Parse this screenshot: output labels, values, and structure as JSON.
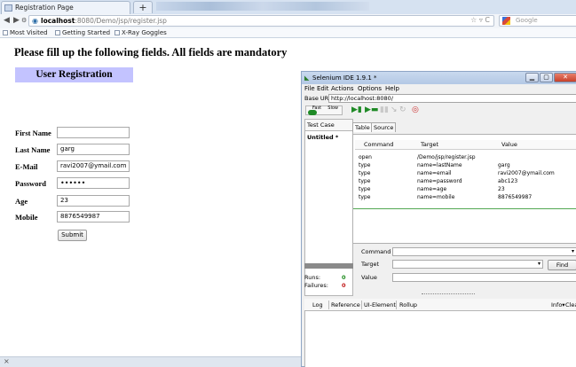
{
  "browser": {
    "tab_title": "Registration Page",
    "new_tab": "+",
    "url_host": "localhost",
    "url_path": ":8080/Demo/jsp/register.jsp",
    "search_placeholder": "Google",
    "bookmarks": [
      "Most Visited",
      "Getting Started",
      "X-Ray Goggles"
    ],
    "status_icon": "×"
  },
  "page": {
    "heading": "Please fill up the following fields. All fields are mandatory",
    "form_title": "User Registration",
    "fields": [
      {
        "label": "First Name",
        "value": ""
      },
      {
        "label": "Last Name",
        "value": "garg"
      },
      {
        "label": "E-Mail",
        "value": "ravi2007@ymail.com"
      },
      {
        "label": "Password",
        "value": "••••••"
      },
      {
        "label": "Age",
        "value": "23"
      },
      {
        "label": "Mobile",
        "value": "8876549987"
      }
    ],
    "submit_label": "Submit"
  },
  "ide": {
    "title": "Selenium IDE 1.9.1 *",
    "menu": [
      "File",
      "Edit",
      "Actions",
      "Options",
      "Help"
    ],
    "base_url_label": "Base URL",
    "base_url": "http://localhost:8080/",
    "speed_fast": "Fast",
    "speed_slow": "Slow",
    "test_case_tab": "Test Case",
    "test_case_item": "Untitled *",
    "tab_table": "Table",
    "tab_source": "Source",
    "columns": [
      "Command",
      "Target",
      "Value"
    ],
    "commands": [
      {
        "command": "open",
        "target": "/Demo/jsp/register.jsp",
        "value": ""
      },
      {
        "command": "type",
        "target": "name=lastName",
        "value": "garg"
      },
      {
        "command": "type",
        "target": "name=email",
        "value": "ravi2007@ymail.com"
      },
      {
        "command": "type",
        "target": "name=password",
        "value": "abc123"
      },
      {
        "command": "type",
        "target": "name=age",
        "value": "23"
      },
      {
        "command": "type",
        "target": "name=mobile",
        "value": "8876549987"
      }
    ],
    "field_command": "Command",
    "field_target": "Target",
    "field_value": "Value",
    "find_label": "Find",
    "runs_label": "Runs:",
    "runs_count": "0",
    "failures_label": "Failures:",
    "failures_count": "0",
    "log_tabs": [
      "Log",
      "Reference",
      "UI-Element",
      "Rollup"
    ],
    "info_label": "Info▾",
    "clear_label": "Clea"
  },
  "colors": {
    "form_title_bg": "#c3c3ff",
    "ide_title_bg": "#b3c8e5",
    "runs_green": "#1a8a1a",
    "fails_red": "#c01515"
  }
}
